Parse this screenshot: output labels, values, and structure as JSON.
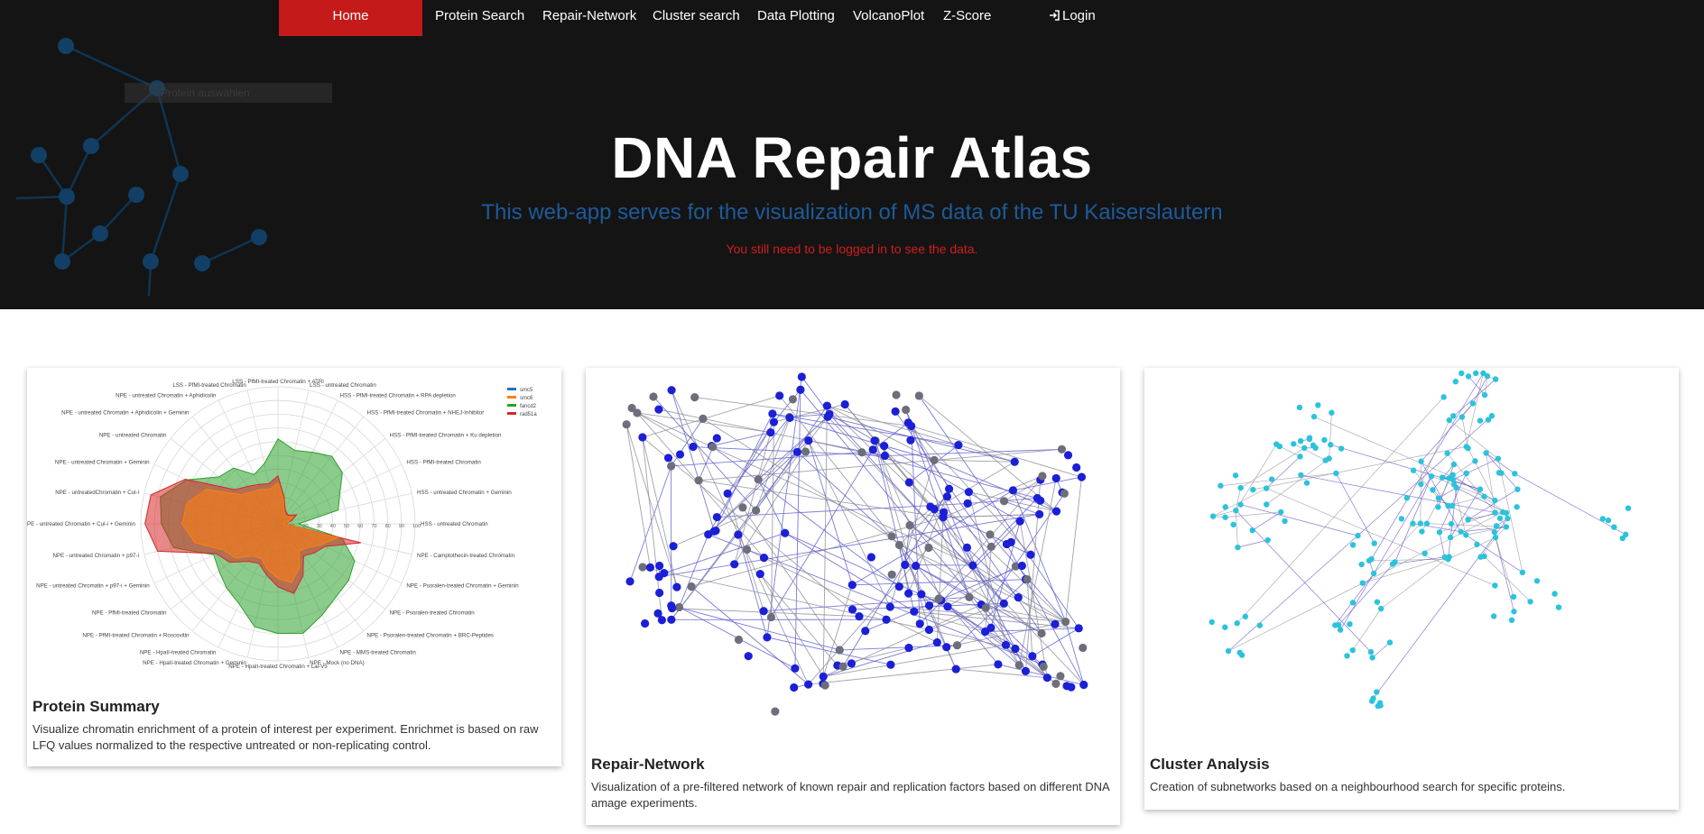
{
  "nav": {
    "items": [
      {
        "label": "Home",
        "active": true
      },
      {
        "label": "Protein Search"
      },
      {
        "label": "Repair-Network"
      },
      {
        "label": "Cluster search"
      },
      {
        "label": "Data Plotting"
      },
      {
        "label": "VolcanoPlot"
      },
      {
        "label": "Z-Score"
      }
    ],
    "login_label": "Login",
    "login_icon": "login-icon"
  },
  "hero": {
    "ghost_input_text": "Protein auswählen",
    "title": "DNA Repair Atlas",
    "subtitle": "This web-app serves for the visualization of MS data of the TU Kaiserslautern",
    "notice": "You still need to be logged in to see the data."
  },
  "cards": [
    {
      "title": "Protein Summary",
      "text": "Visualize chromatin enrichment of a protein of interest per experiment. Enrichmet is based on raw LFQ values normalized to the respective untreated or non-replicating control.",
      "radar": {
        "legend": [
          "smc5",
          "smc6",
          "fancd2",
          "rad51a"
        ],
        "legend_colors": [
          "#1f77b4",
          "#ff7f0e",
          "#2ca02c",
          "#d62728"
        ],
        "radial_ticks": [
          "10",
          "20",
          "30",
          "40",
          "50",
          "60",
          "70",
          "80",
          "90",
          "100"
        ],
        "axis_labels": [
          "LSS - PfMI-treated Chromatin + ATRi",
          "LSS - untreated Chromatin",
          "HSS - PfMI-treated Chromatin + RPA depletion",
          "HSS - PfMI-treated Chromatin + NHEJ-Inhibitor",
          "HSS - PfMI-treated Chromatin + Ku depletion",
          "HSS - PfMI-treated Chromatin",
          "HSS - untreated Chromatin + Geminin",
          "HSS - untreated Chromatin",
          "NPE - Camptothecin-treated Chromatin",
          "NPE - Psoralen-treated Chromatin + Geminin",
          "NPE - Psoralen-treated Chromatin",
          "NPE - Psoralen-treated Chromatin + BRC-Peptides",
          "NPE - MMS-treated Chromatin",
          "NPE - Mock (no DNA)",
          "NPE - HpaII-treated Chromatin + Lai-V5",
          "NPE - HpaII-treated Chromatin + Geminin",
          "NPE - HpaII-treated Chromatin",
          "NPE - PfMI-treated Chromatin + Roscovitin",
          "NPE - PfMI-treated Chromatin",
          "NPE - untreated Chromatin + p97-i + Geminin",
          "NPE - untreated Chromatin + p97-i",
          "NPE - untreated Chromatin + Cul-i + Geminin",
          "NPE - untreatedChromatin + Cul-i",
          "NPE - untreated Chromatin + Geminin",
          "NPE - untreated Chromatin",
          "NPE - untreated Chromatin + Aphidicolin + Geminin",
          "NPE - untreated Chromatin + Aphidicolin",
          "LSS - PfMI-treated Chromatin"
        ]
      }
    },
    {
      "title": "Repair-Network",
      "text": "Visualization of a pre-filtered network of known repair and replication factors based on different DNA amage experiments."
    },
    {
      "title": "Cluster Analysis",
      "text": "Creation of subnetworks based on a neighbourhood search for specific proteins."
    }
  ],
  "colors": {
    "hero_bg": "#141414",
    "nav_active": "#c41a1a",
    "subtitle": "#1e5a99",
    "notice": "#d11d1d",
    "network_node_blue": "#1b1fd6",
    "network_node_gray": "#6e6e7a",
    "cluster_node": "#2bc3dc"
  }
}
